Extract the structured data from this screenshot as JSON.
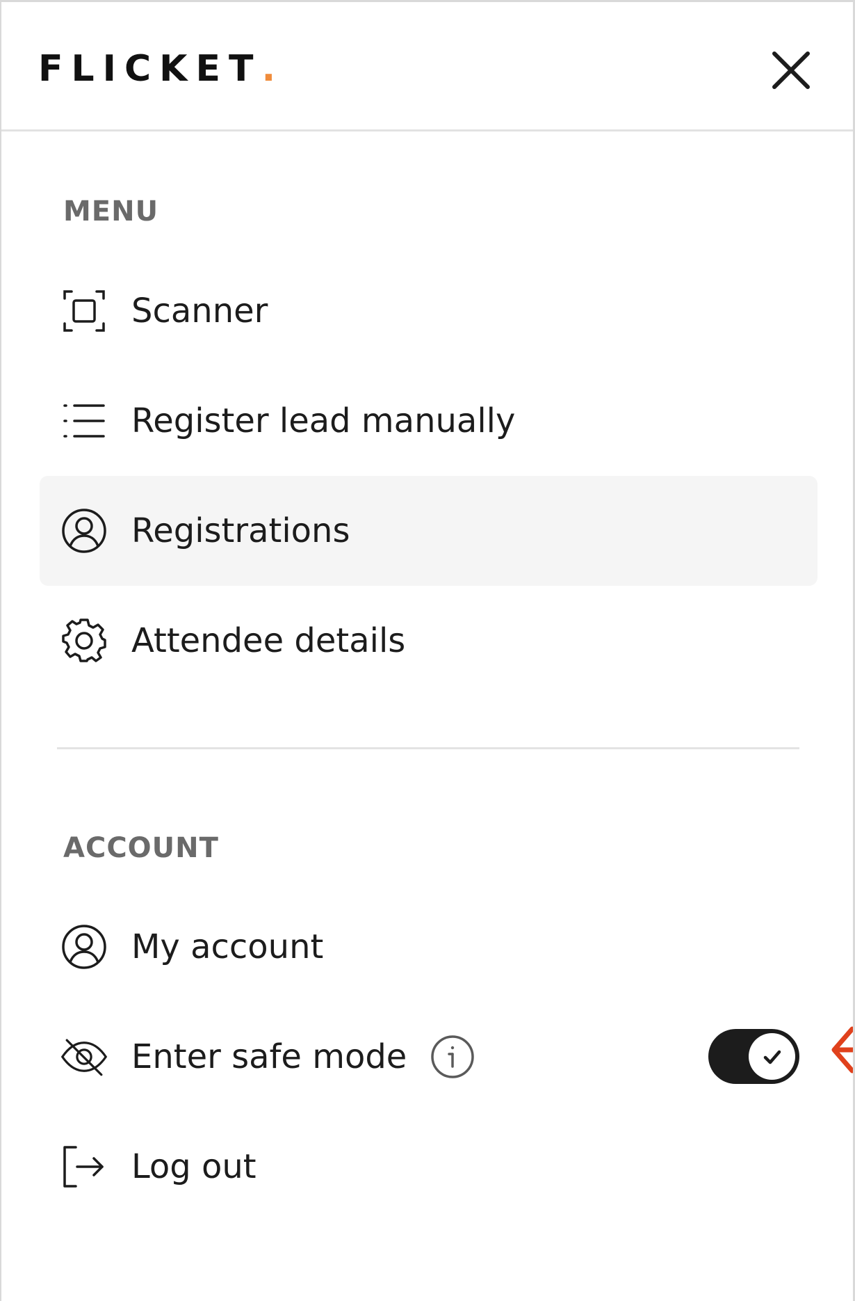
{
  "brand": {
    "name": "FLICKET",
    "dot": ".",
    "accent": "#f08c3c"
  },
  "menu": {
    "heading": "MENU",
    "items": [
      {
        "label": "Scanner",
        "icon": "scan-icon"
      },
      {
        "label": "Register lead manually",
        "icon": "list-icon"
      },
      {
        "label": "Registrations",
        "icon": "user-circle-icon",
        "active": true
      },
      {
        "label": "Attendee details",
        "icon": "gear-icon"
      }
    ]
  },
  "account": {
    "heading": "ACCOUNT",
    "items": [
      {
        "label": "My account",
        "icon": "user-circle-icon"
      },
      {
        "label": "Enter safe mode",
        "icon": "eye-off-icon",
        "info_icon": "info-icon",
        "toggle": {
          "on": true,
          "icon": "check-icon"
        }
      },
      {
        "label": "Log out",
        "icon": "logout-icon"
      }
    ]
  },
  "colors": {
    "toggle_on": "#1c1c1c",
    "annotation": "#e0411c",
    "active_bg": "#f5f5f5"
  }
}
